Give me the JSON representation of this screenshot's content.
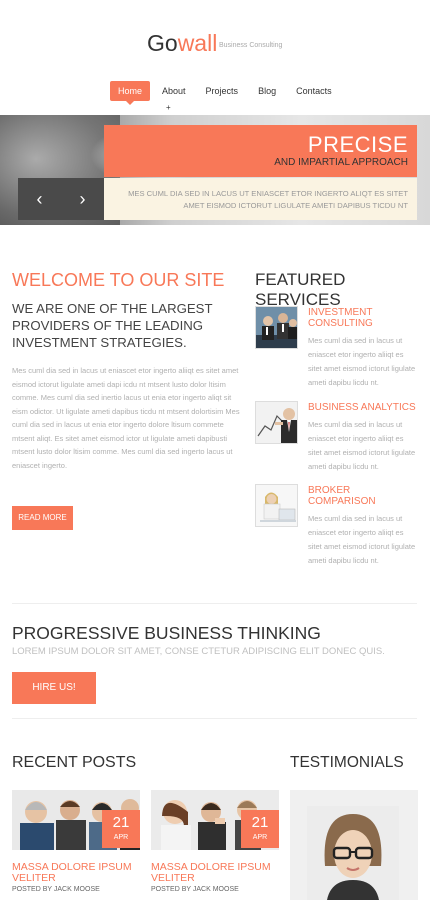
{
  "header": {
    "logo_part1": "Go",
    "logo_part2": "wall",
    "tagline": "Business Consulting"
  },
  "nav": {
    "items": [
      "Home",
      "About",
      "Projects",
      "Blog",
      "Contacts"
    ],
    "active": "Home",
    "plus": "+"
  },
  "slider": {
    "title": "PRECISE",
    "subtitle": "AND IMPARTIAL APPROACH",
    "text": "MES CUML DIA SED IN LACUS UT ENIASCET ETOR INGERTO ALIQT ES SITET AMET EISMOD ICTORUT LIGULATE AMETI DAPIBUS TICDU NT",
    "prev_icon": "chevron-left-icon",
    "next_icon": "chevron-right-icon"
  },
  "welcome": {
    "heading": "WELCOME TO OUR SITE",
    "lead": "WE ARE ONE OF THE LARGEST PROVIDERS OF THE LEADING INVESTMENT STRATEGIES.",
    "text": "Mes cuml dia sed in lacus ut eniascet etor ingerto aliiqt es sitet amet eismod ictorut ligulate ameti dapi icdu nt mtsent lusto dolor ltisim comme. Mes cuml dia sed inertio lacus ut enia etor ingerto aliqt sit eism odictor. Ut ligulate ameti dapibus ticdu nt mtsent dolortisim Mes cuml dia sed in lacus ut enia etor ingerto dolore ltisum commete mtsent aliqt. Es sitet amet eismod ictor ut ligulate ameti dapibusti mtsent lusto dolor ltisim comme. Mes cuml dia sed ingerto lacus ut eniascet ingerto.",
    "button": "READ MORE"
  },
  "featured": {
    "heading": "FEATURED SERVICES",
    "services": [
      {
        "title": "INVESTMENT CONSULTING",
        "text": "Mes cuml dia sed in lacus ut eniascet etor ingerto aliiqt es sitet amet eismod ictorut ligulate ameti dapibu licdu nt."
      },
      {
        "title": "BUSINESS ANALYTICS",
        "text": "Mes cuml dia sed in lacus ut eniascet etor ingerto aliiqt es sitet amet eismod ictorut ligulate ameti dapibu licdu nt."
      },
      {
        "title": "BROKER COMPARISON",
        "text": "Mes cuml dia sed in lacus ut eniascet etor ingerto aliiqt es sitet amet eismod ictorut ligulate ameti dapibu licdu nt."
      }
    ]
  },
  "progressive": {
    "heading": "PROGRESSIVE BUSINESS THINKING",
    "sub": "LOREM IPSUM DOLOR SIT AMET, CONSE CTETUR ADIPISCING ELIT DONEC QUIS.",
    "button": "HIRE US!"
  },
  "posts": {
    "heading": "RECENT POSTS",
    "items": [
      {
        "day": "21",
        "month": "APR",
        "title": "MASSA DOLORE IPSUM VELITER",
        "by": "POSTED BY JACK MOOSE"
      },
      {
        "day": "21",
        "month": "APR",
        "title": "MASSA DOLORE IPSUM VELITER",
        "by": "POSTED BY JACK MOOSE"
      }
    ]
  },
  "testimonials": {
    "heading": "TESTIMONIALS"
  },
  "colors": {
    "accent": "#f87858",
    "dark": "#4a4a4a",
    "cream": "#faf3e2"
  }
}
